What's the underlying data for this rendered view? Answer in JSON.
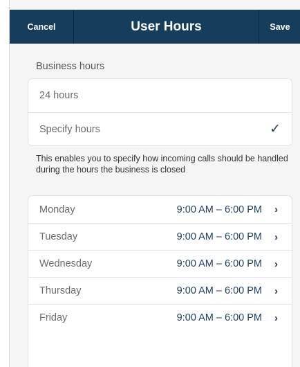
{
  "header": {
    "cancel_label": "Cancel",
    "title": "User Hours",
    "save_label": "Save"
  },
  "business_hours": {
    "section_label": "Business hours",
    "options": [
      {
        "label": "24 hours",
        "selected": false
      },
      {
        "label": "Specify hours",
        "selected": true
      }
    ],
    "check_glyph": "✓",
    "info_text": "This enables you to specify how incoming calls should be handled during the hours the business is closed"
  },
  "days": [
    {
      "day": "Monday",
      "hours": "9:00 AM – 6:00 PM"
    },
    {
      "day": "Tuesday",
      "hours": "9:00 AM – 6:00 PM"
    },
    {
      "day": "Wednesday",
      "hours": "9:00 AM – 6:00 PM"
    },
    {
      "day": "Thursday",
      "hours": "9:00 AM – 6:00 PM"
    },
    {
      "day": "Friday",
      "hours": "9:00 AM – 6:00 PM"
    }
  ],
  "chevron_glyph": "›",
  "colors": {
    "header_bg": "#173d5c",
    "accent": "#1d3f66",
    "background": "#f5f5f5"
  }
}
